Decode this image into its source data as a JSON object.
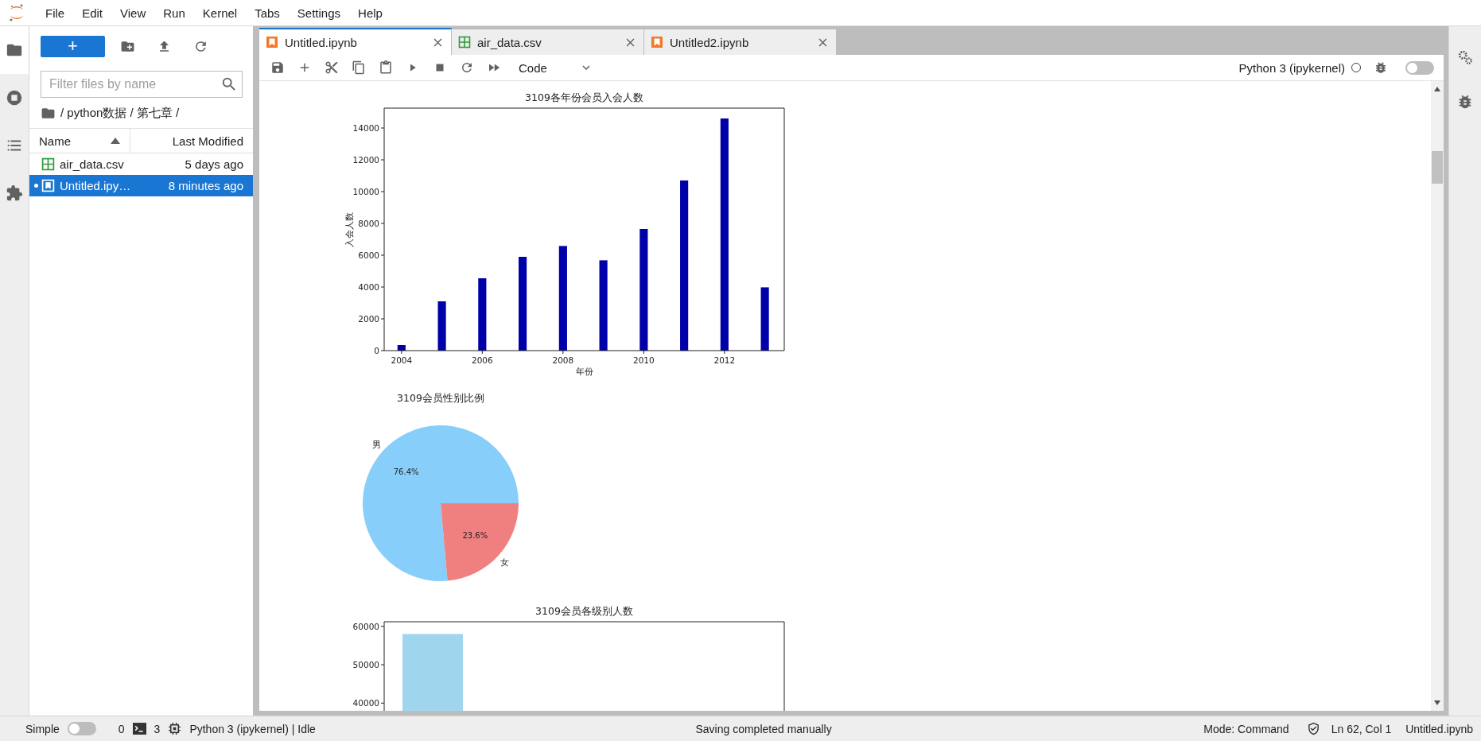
{
  "menu_bar": {
    "items": [
      "File",
      "Edit",
      "View",
      "Run",
      "Kernel",
      "Tabs",
      "Settings",
      "Help"
    ]
  },
  "left_rail": [
    {
      "kind": "folder",
      "selected": true
    },
    {
      "kind": "running",
      "selected": false
    },
    {
      "kind": "toc",
      "selected": false
    },
    {
      "kind": "extensions",
      "selected": false
    }
  ],
  "file_browser": {
    "new_button": "+",
    "filter": {
      "placeholder": "Filter files by name"
    },
    "breadcrumbs": "/ python数据 / 第七章 /",
    "columns": [
      {
        "label": "Name",
        "sorted": true
      },
      {
        "label": "Last Modified",
        "sorted": false
      }
    ],
    "files": [
      {
        "kind": "csv",
        "name": "air_data.csv",
        "modified": "5 days ago",
        "selected": false,
        "running": false
      },
      {
        "kind": "notebook",
        "name": "Untitled.ipy…",
        "modified": "8 minutes ago",
        "selected": true,
        "running": true
      }
    ]
  },
  "tabs": [
    {
      "kind": "notebook",
      "label": "Untitled.ipynb",
      "selected": true
    },
    {
      "kind": "csv",
      "label": "air_data.csv",
      "selected": false
    },
    {
      "kind": "notebook",
      "label": "Untitled2.ipynb",
      "selected": false
    }
  ],
  "toolbar": {
    "cell_type": "Code",
    "kernel": "Python 3 (ipykernel)",
    "kernel_busy": false,
    "debugger_on": false
  },
  "outputs": [
    {
      "chart_data": {
        "type": "bar",
        "title": "3109各年份会员入会人数",
        "xlabel": "年份",
        "ylabel": "入会人数",
        "x": [
          2004,
          2005,
          2006,
          2007,
          2008,
          2009,
          2010,
          2011,
          2012,
          2013
        ],
        "series": [
          {
            "color": "#0000aa",
            "values": [
              350,
              3100,
              4550,
              5900,
              6580,
              5680,
              7650,
              10700,
              14600,
              3980
            ]
          }
        ],
        "xlim": [
          2003.57,
          2013.48
        ],
        "ylim": [
          0,
          15250
        ],
        "xticks": [
          2004,
          2006,
          2008,
          2010,
          2012
        ],
        "yticks": [
          0,
          2000,
          4000,
          6000,
          8000,
          10000,
          12000,
          14000
        ]
      }
    },
    {
      "chart_data": {
        "type": "pie",
        "title": "3109会员性别比例",
        "categories": [
          "男",
          "女"
        ],
        "values": [
          76.4,
          23.6
        ],
        "colors": [
          "#87cefa",
          "#f08080"
        ],
        "value_labels": [
          "76.4%",
          "23.6%"
        ]
      }
    },
    {
      "chart_data": {
        "type": "bar",
        "title": "3109会员各级别人数",
        "series": [
          {
            "color": "#9fd6ee",
            "values": [
              58000
            ]
          }
        ],
        "ylim": [
          38000,
          61200
        ],
        "yticks": [
          40000,
          50000,
          60000
        ]
      }
    }
  ],
  "right_rail": [
    {
      "kind": "property-inspector"
    },
    {
      "kind": "debugger"
    }
  ],
  "status_bar": {
    "simple_mode": {
      "label": "Simple",
      "on": false
    },
    "terminals": "0",
    "kernels": "3",
    "kernel_status": "Python 3 (ipykernel) | Idle",
    "message": "Saving completed manually",
    "mode": "Mode: Command",
    "position": "Ln 62, Col 1",
    "file": "Untitled.ipynb"
  }
}
